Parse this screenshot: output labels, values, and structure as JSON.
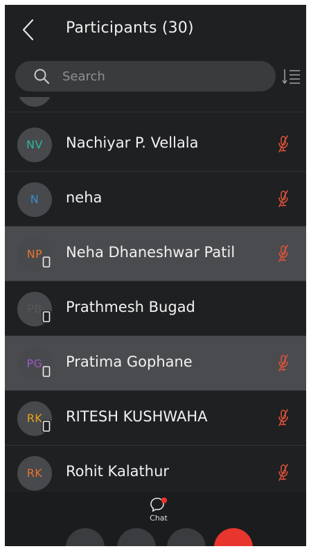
{
  "header": {
    "title": "Participants (30)",
    "back_icon": "chevron-left-icon"
  },
  "search": {
    "placeholder": "Search",
    "value": "",
    "icon": "search-icon"
  },
  "sort": {
    "icon": "sort-list-icon"
  },
  "participants": [
    {
      "initials": "NV",
      "name": "Nachiyar P. Vellala",
      "initials_color": "#2fb5a0",
      "on_mobile": false,
      "muted": true,
      "highlighted": false
    },
    {
      "initials": "N",
      "name": "neha",
      "initials_color": "#3b8fd1",
      "on_mobile": false,
      "muted": true,
      "highlighted": false
    },
    {
      "initials": "NP",
      "name": "Neha Dhaneshwar Patil",
      "initials_color": "#e8742e",
      "on_mobile": true,
      "muted": true,
      "highlighted": true
    },
    {
      "initials": "PB",
      "name": "Prathmesh Bugad",
      "initials_color": "#555759",
      "on_mobile": true,
      "muted": false,
      "highlighted": false
    },
    {
      "initials": "PG",
      "name": "Pratima Gophane",
      "initials_color": "#9b58c4",
      "on_mobile": true,
      "muted": true,
      "highlighted": true
    },
    {
      "initials": "RK",
      "name": "RITESH KUSHWAHA",
      "initials_color": "#e6a317",
      "on_mobile": true,
      "muted": true,
      "highlighted": false
    },
    {
      "initials": "RK",
      "name": "Rohit Kalathur",
      "initials_color": "#e8742e",
      "on_mobile": false,
      "muted": true,
      "highlighted": false
    }
  ],
  "toolbar": {
    "chat_label": "Chat",
    "chat_icon": "chat-bubble-icon",
    "has_unread": true
  },
  "colors": {
    "background": "#1f2022",
    "highlight": "#4a4b4e",
    "muted_mic": "#e2533a",
    "unread_dot": "#e8352d",
    "leave_button": "#e8352d"
  }
}
